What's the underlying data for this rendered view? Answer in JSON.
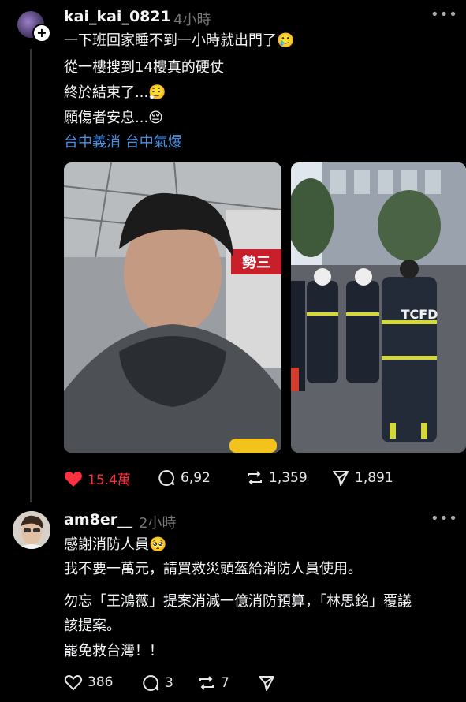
{
  "post": {
    "username": "kai_kai_0821",
    "time": "4小時",
    "lines": [
      "一下班回家睡不到一小時就出門了🥲",
      "從一樓搜到14樓真的硬仗",
      "終於結束了...😮‍💨",
      "願傷者安息...😔"
    ],
    "tags": [
      "台中義消",
      "台中氣爆"
    ],
    "images": [
      {
        "alt": "selfie in hoodie"
      },
      {
        "alt": "firefighters TCFD",
        "jacket_text": "TCFD"
      }
    ],
    "actions": {
      "likes": "15.4萬",
      "comments": "6,92",
      "reposts": "1,359",
      "shares": "1,891"
    }
  },
  "reply": {
    "username": "am8er__",
    "time": "2小時",
    "lines": [
      "感謝消防人員🥺",
      "我不要一萬元，請買救災頭盔給消防人員使用。",
      "勿忘「王鴻薇」提案消減一億消防預算，「林思銘」覆議",
      "該提案。",
      "罷免救台灣！！"
    ],
    "actions": {
      "likes": "386",
      "comments": "3",
      "reposts": "7"
    }
  },
  "colors": {
    "accent_like": "#ff3040",
    "tag_blue": "#4a90e2",
    "bg": "#000000"
  }
}
